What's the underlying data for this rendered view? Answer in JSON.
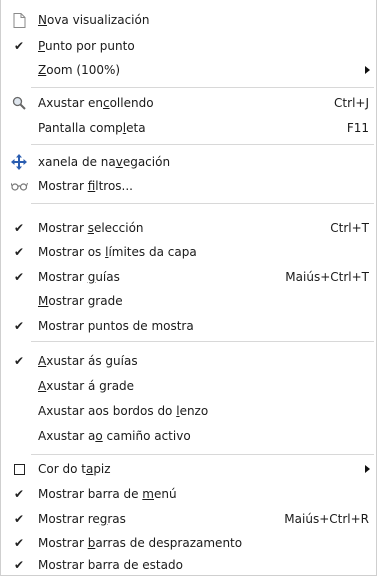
{
  "menu": {
    "items": [
      {
        "id": "nova",
        "pre": "",
        "u": "N",
        "post": "ova visualización",
        "shortcut": "",
        "icon": "new-document-icon"
      },
      {
        "id": "punto",
        "pre": "",
        "u": "P",
        "post": "unto por punto",
        "shortcut": "",
        "icon": "checkmark-icon"
      },
      {
        "id": "zoom",
        "pre": "",
        "u": "Z",
        "post": "oom (100%)",
        "shortcut": "",
        "icon": ""
      },
      {
        "id": "axustar-encollendo",
        "pre": "Axustar en",
        "u": "c",
        "post": "ollendo",
        "shortcut": "Ctrl+J",
        "icon": "zoom-fit-icon"
      },
      {
        "id": "pantalla-completa",
        "pre": "Pantalla comp",
        "u": "l",
        "post": "eta",
        "shortcut": "F11",
        "icon": ""
      },
      {
        "id": "xanela-navegacion",
        "pre": "xanela de na",
        "u": "v",
        "post": "egación",
        "shortcut": "",
        "icon": "navigate-move-icon"
      },
      {
        "id": "mostrar-filtros",
        "pre": "Mostrar ",
        "u": "f",
        "post": "iltros...",
        "shortcut": "",
        "icon": "glasses-icon"
      },
      {
        "id": "mostrar-seleccion",
        "pre": "Mostrar ",
        "u": "s",
        "post": "elección",
        "shortcut": "Ctrl+T",
        "icon": "checkmark-icon"
      },
      {
        "id": "mostrar-limites",
        "pre": "Mostrar os ",
        "u": "l",
        "post": "ímites da capa",
        "shortcut": "",
        "icon": "checkmark-icon"
      },
      {
        "id": "mostrar-guias",
        "pre": "Mostrar ",
        "u": "g",
        "post": "uías",
        "shortcut": "Maiús+Ctrl+T",
        "icon": "checkmark-icon"
      },
      {
        "id": "mostrar-grade",
        "pre": "",
        "u": "M",
        "post": "ostrar grade",
        "shortcut": "",
        "icon": ""
      },
      {
        "id": "mostrar-puntos",
        "pre": "Mostrar puntos de mostra",
        "u": "",
        "post": "",
        "shortcut": "",
        "icon": "checkmark-icon"
      },
      {
        "id": "axustar-guias",
        "pre": "",
        "u": "A",
        "post": "xustar ás guías",
        "shortcut": "",
        "icon": "checkmark-icon"
      },
      {
        "id": "axustar-grade",
        "pre": "",
        "u": "A",
        "post": "xustar á grade",
        "shortcut": "",
        "icon": ""
      },
      {
        "id": "axustar-bordos",
        "pre": "Axustar aos bordos do ",
        "u": "l",
        "post": "enzo",
        "shortcut": "",
        "icon": ""
      },
      {
        "id": "axustar-camino",
        "pre": "Axustar a",
        "u": "o",
        "post": " camiño activo",
        "shortcut": "",
        "icon": ""
      },
      {
        "id": "cor-tapiz",
        "pre": "Cor do t",
        "u": "a",
        "post": "piz",
        "shortcut": "",
        "icon": "checkbox-empty-icon"
      },
      {
        "id": "barra-menu",
        "pre": "Mostrar barra de ",
        "u": "m",
        "post": "enú",
        "shortcut": "",
        "icon": "checkmark-icon"
      },
      {
        "id": "regras",
        "pre": "Mostrar re",
        "u": "g",
        "post": "ras",
        "shortcut": "Maiús+Ctrl+R",
        "icon": "checkmark-icon"
      },
      {
        "id": "barras-desprazamento",
        "pre": "Mostrar ",
        "u": "b",
        "post": "arras de desprazamento",
        "shortcut": "",
        "icon": "checkmark-icon"
      },
      {
        "id": "barra-estado",
        "pre": "Mostrar barra de estado",
        "u": "",
        "post": "",
        "shortcut": "",
        "icon": "checkmark-icon"
      }
    ]
  }
}
